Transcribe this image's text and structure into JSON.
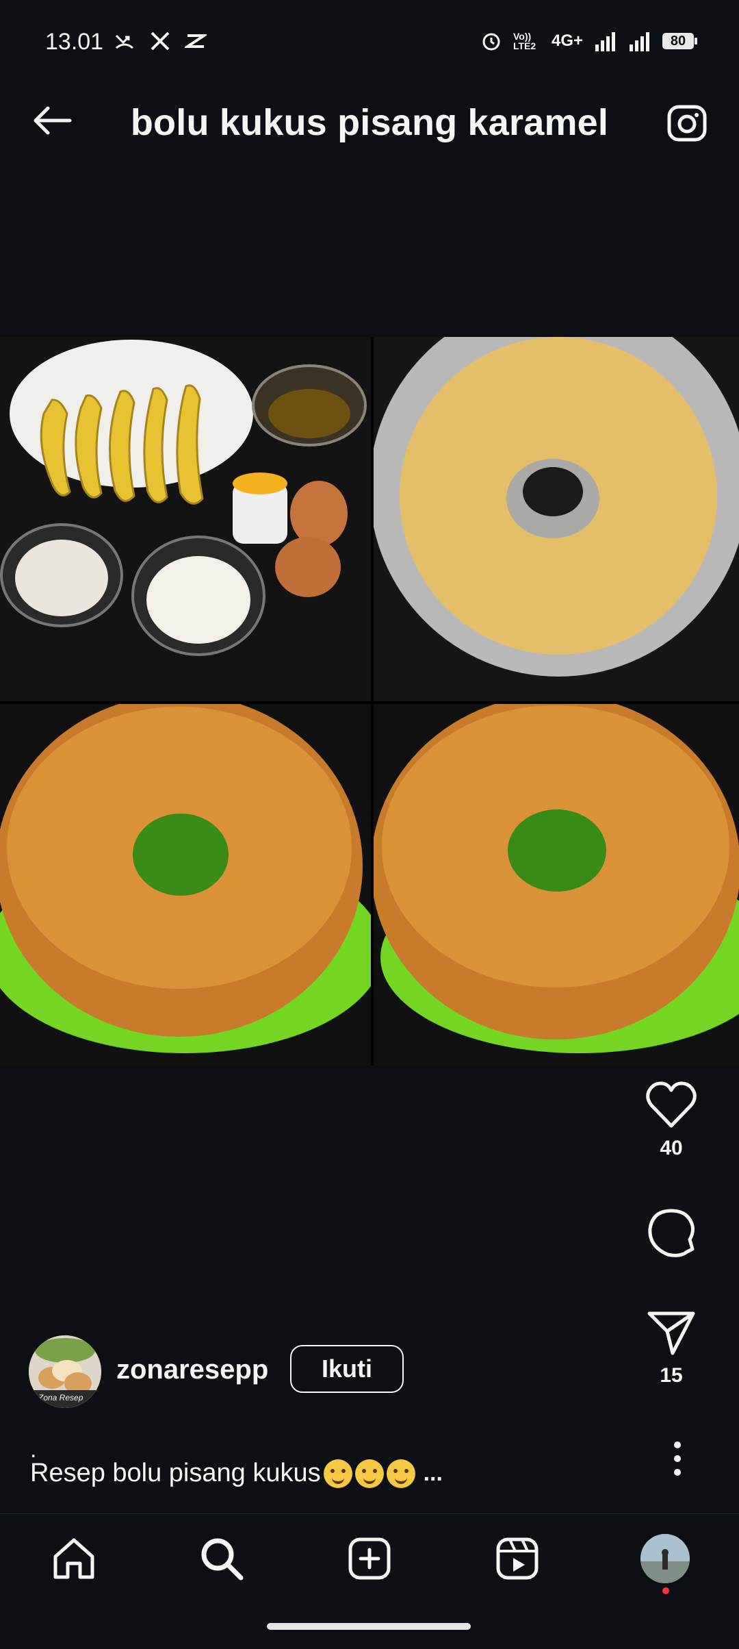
{
  "status_bar": {
    "time": "13.01",
    "battery": "80",
    "network": "4G+",
    "volte": "Vo)) LTE2"
  },
  "header": {
    "title": "bolu kukus pisang karamel"
  },
  "actions": {
    "likes": "40",
    "shares": "15"
  },
  "author": {
    "username": "zonaresepp",
    "follow_label": "Ikuti",
    "avatar_text": "Zona Resep"
  },
  "caption": {
    "dot": ".",
    "text": "Resep bolu pisang kukus",
    "ellipsis": "..."
  },
  "colors": {
    "background": "#0c1014",
    "text": "#f5f5f5",
    "notification": "#ff3040"
  }
}
